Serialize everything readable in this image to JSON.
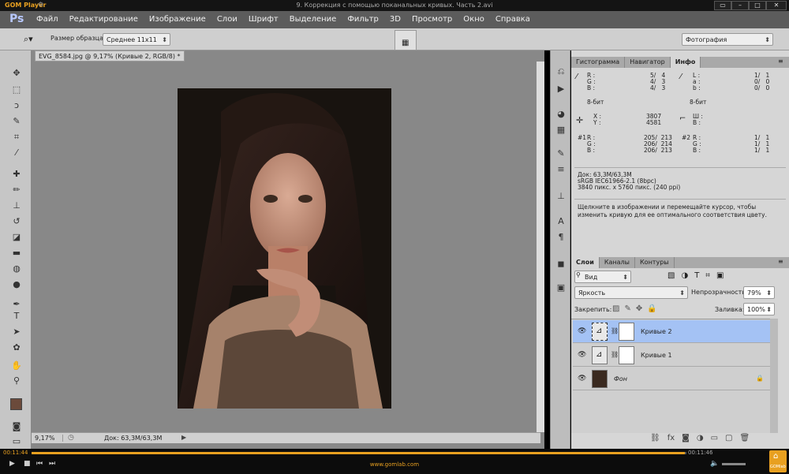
{
  "gom": {
    "logo": "GOM Player",
    "title": "9. Коррекция с помощью поканальных кривых. Часть 2.avi",
    "time_current": "00:11:44",
    "time_total": "00:11:46",
    "url": "www.gomlab.com",
    "home_label": "GOMlab"
  },
  "ps": {
    "logo": "Ps",
    "menu": [
      "Файл",
      "Редактирование",
      "Изображение",
      "Слои",
      "Шрифт",
      "Выделение",
      "Фильтр",
      "3D",
      "Просмотр",
      "Окно",
      "Справка"
    ],
    "options": {
      "sample_label": "Размер образца:",
      "sample_value": "Среднее 11х11",
      "workspace": "Фотография"
    },
    "document": {
      "tab_title": "EVG_8584.jpg @ 9,17% (Кривые 2, RGB/8) *",
      "zoom": "9,17%",
      "doc_size": "Док: 63,3M/63,3M"
    },
    "info_panel": {
      "tabs": [
        "Гистограмма",
        "Навигатор",
        "Инфо"
      ],
      "rgb_labels": [
        "R :",
        "G :",
        "B :"
      ],
      "rgb_values": [
        "5/   4",
        "4/   3",
        "4/   3"
      ],
      "lab_labels": [
        "L :",
        "a :",
        "b :"
      ],
      "lab_values": [
        "1/   1",
        "0/   0",
        "0/   0"
      ],
      "bit1": "8-бит",
      "bit2": "8-бит",
      "xy_labels": [
        "X :",
        "Y :"
      ],
      "xy_values": [
        "3807",
        "4581"
      ],
      "wh_labels": [
        "Ш :",
        "В :"
      ],
      "s1_label": "#1",
      "s1_labels": [
        "R :",
        "G :",
        "B :"
      ],
      "s1_values": [
        "205/  213",
        "206/  214",
        "206/  213"
      ],
      "s2_label": "#2",
      "s2_labels": [
        "R :",
        "G :",
        "B :"
      ],
      "s2_values": [
        "1/   1",
        "1/   1",
        "1/   1"
      ],
      "doc_line": "Док: 63,3M/63,3M",
      "profile_line": "sRGB IEC61966-2.1 (8bpc)",
      "pixels_line": "3840 пикс. x 5760 пикс. (240 ppi)",
      "hint": "Щелкните в изображении и перемещайте курсор, чтобы\nизменить кривую для ее оптимального соответствия цвету."
    },
    "layers_panel": {
      "tabs": [
        "Слои",
        "Каналы",
        "Контуры"
      ],
      "filter_kind": "Вид",
      "blend_mode": "Яркость",
      "opacity_label": "Непрозрачность:",
      "opacity_value": "79%",
      "lock_label": "Закрепить:",
      "fill_label": "Заливка:",
      "fill_value": "100%",
      "layers": [
        {
          "name": "Кривые 2",
          "selected": true
        },
        {
          "name": "Кривые 1",
          "selected": false
        },
        {
          "name": "Фон",
          "selected": false
        }
      ]
    }
  }
}
